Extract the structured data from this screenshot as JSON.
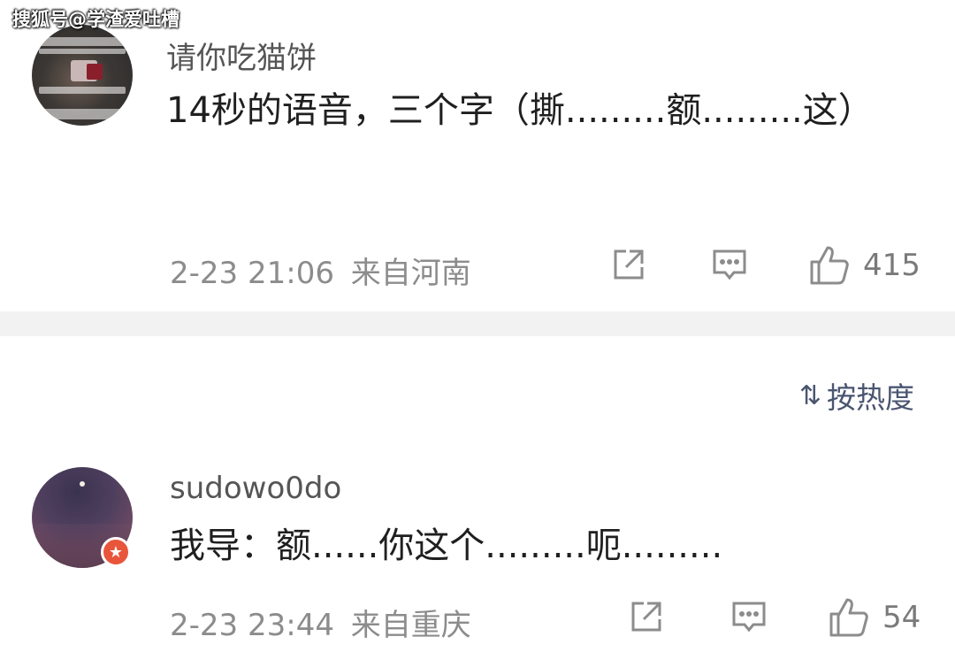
{
  "watermark": "搜狐号@学渣爱吐槽",
  "comments": [
    {
      "username": "请你吃猫饼",
      "text": "14秒的语音，三个字（撕.........额.........这）",
      "time": "2-23 21:06",
      "location": "来自河南",
      "likes": "415"
    },
    {
      "username": "sudowo0do",
      "text": "我导：额......你这个.........呃.........",
      "time": "2-23 23:44",
      "location": "来自重庆",
      "likes": "54"
    }
  ],
  "sort": {
    "label": "按热度",
    "icon": "sort-icon"
  },
  "icons": {
    "share": "share-icon",
    "reply": "comment-icon",
    "like": "thumbs-up-icon",
    "badge": "vip-star-icon"
  },
  "colors": {
    "badge": "#e9553a",
    "divider": "#f2f2f2",
    "meta": "#8c8c8c",
    "sort": "#4a5570"
  }
}
